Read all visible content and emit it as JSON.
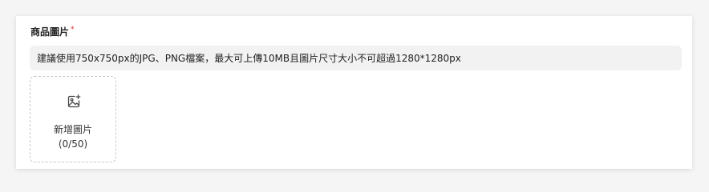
{
  "field": {
    "label": "商品圖片",
    "required_mark": "*",
    "hint": "建議使用750x750px的JPG、PNG檔案，最大可上傳10MB且圖片尺寸大小不可超過1280*1280px"
  },
  "upload": {
    "icon": "image-add-icon",
    "label": "新增圖片",
    "count": "(0/50)"
  },
  "colors": {
    "required": "#e02424",
    "hint_bg": "#f2f2f2",
    "dashed_border": "#c9c9c9"
  }
}
